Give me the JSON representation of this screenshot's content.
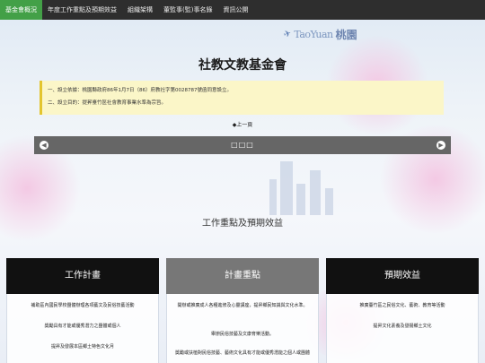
{
  "nav": {
    "items": [
      {
        "label": "基金會概況",
        "active": true
      },
      {
        "label": "年度工作重點及預期效益",
        "active": false
      },
      {
        "label": "組織架構",
        "active": false
      },
      {
        "label": "董監事(監)事名錄",
        "active": false
      },
      {
        "label": "資訊公開",
        "active": false
      }
    ]
  },
  "logo": {
    "en": "TaoYuan",
    "zh": "桃園"
  },
  "page": {
    "title": "社教文教基金會"
  },
  "notice": {
    "line1": "一、設立依據：桃園縣政府86年1月7日（86）府教社字第0028787號函同意設立。",
    "line2": "二、設立目的：提昇臺竹區社會教育事業水準為宗旨。"
  },
  "prev_link": "◆上一頁",
  "slider": {
    "dots": "□□□",
    "left_icon": "chevron-left-icon",
    "right_icon": "chevron-right-icon"
  },
  "section": {
    "title": "工作重點及預期效益"
  },
  "columns": [
    {
      "header": "工作計畫",
      "entries": [
        "補助區內國民學校團體辦理各項藝文及民俗技藝活動",
        "獎勵具有才能或優秀潛力之團體或個人",
        "提昇及發展本區鄉土特色文化月"
      ]
    },
    {
      "header": "計畫重點",
      "entries": [
        "開辦或推廣成人各種進修及心靈講座，提昇鄉民知識與文化水準。",
        "舉辦民俗技藝及文康育樂活動。",
        "獎勵或扶植對民俗技藝、藝術文化具有才能或優秀潛能之個人或團體"
      ]
    },
    {
      "header": "預期效益",
      "entries": [
        "推廣臺竹區之民俗文化、藝術、教育等活動",
        "提昇文化素養及發揚鄉土文化"
      ]
    }
  ],
  "colors": {
    "nav_bg": "#2e2e2e",
    "nav_active": "#43a047",
    "notice_bg": "#fbf6c8",
    "slider_bg": "#666666"
  }
}
